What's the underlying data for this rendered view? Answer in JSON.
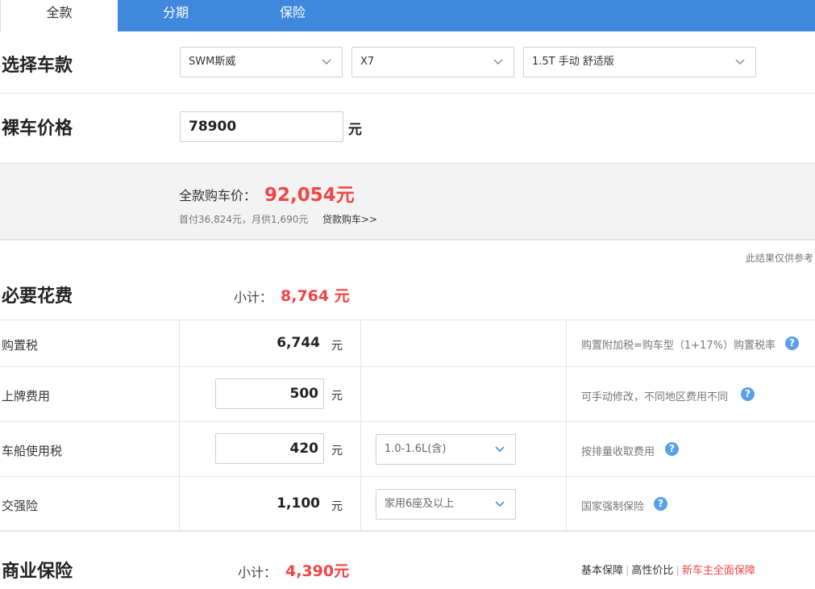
{
  "tabs": [
    "全款",
    "分期",
    "保险"
  ],
  "vehicle": {
    "title": "选择车款",
    "brand": "SWM斯威",
    "model": "X7",
    "trim": "1.5T 手动 舒适版"
  },
  "bare_price": {
    "title": "裸车价格",
    "value": "78900",
    "unit": "元"
  },
  "summary": {
    "total_label": "全款购车价：",
    "total_value": "92,054元",
    "sub_line": "首付36,824元，月供1,690元",
    "loan_link": "贷款购车>>"
  },
  "note": "此结果仅供参考",
  "required": {
    "title": "必要花费",
    "subtotal_label": "小计：",
    "subtotal_value": "8,764 元",
    "rows": [
      {
        "label": "购置税",
        "value": "6,744",
        "unit": "元",
        "desc": "购置附加税=购车型（1+17%）购置税率"
      },
      {
        "label": "上牌费用",
        "value": "500",
        "unit": "元",
        "desc": "可手动修改，不同地区费用不同"
      },
      {
        "label": "车船使用税",
        "value": "420",
        "unit": "元",
        "select": "1.0-1.6L(含)",
        "desc": "按排量收取费用"
      },
      {
        "label": "交强险",
        "value": "1,100",
        "unit": "元",
        "select": "家用6座及以上",
        "desc": "国家强制保险"
      }
    ]
  },
  "commercial": {
    "title": "商业保险",
    "subtotal_label": "小计：",
    "subtotal_value": "4,390元",
    "links": [
      "基本保障",
      "高性价比",
      "新车主全面保障"
    ]
  },
  "colors": {
    "tab_bar": "#3f88dd",
    "accent_red": "#f04646",
    "help_icon": "#5aa0e8"
  },
  "icons": {
    "help": "question-mark",
    "select_arrow": "chevron-down"
  }
}
